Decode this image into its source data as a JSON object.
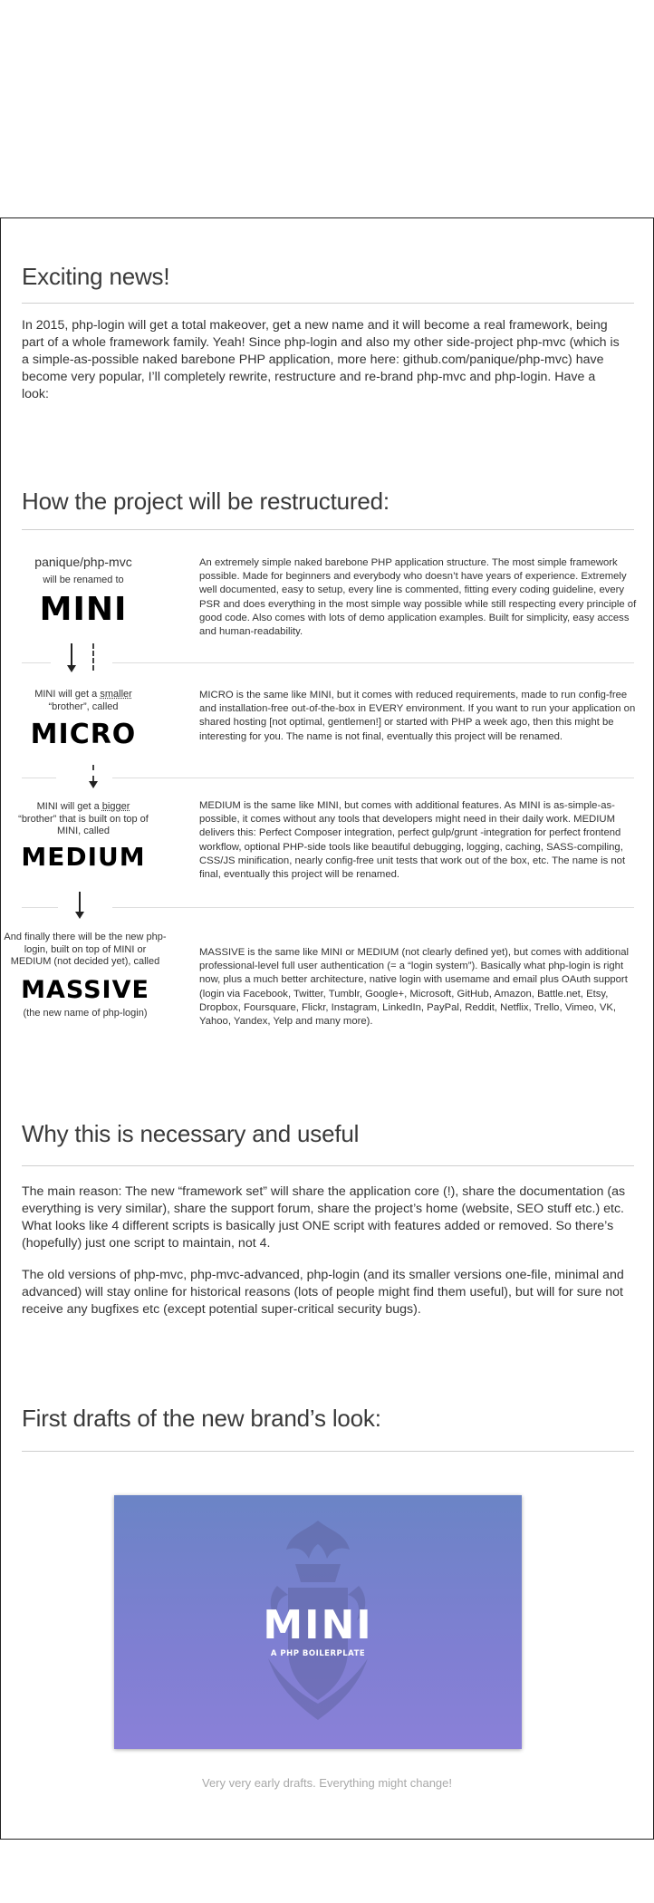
{
  "news": {
    "title": "Exciting news!",
    "intro": "In 2015, php-login will get a total makeover, get a new name and it will become a real framework, being part of a whole framework family. Yeah! Since php-login and also my other side-project php-mvc (which is a simple-as-possible naked barebone PHP application, more here: github.com/panique/php-mvc) have become very popular, I’ll completely rewrite, restructure and re-brand php-mvc and php-login. Have a look:"
  },
  "restructure": {
    "title": "How the project will be restructured:",
    "mini": {
      "repo": "panique/php-mvc",
      "note": "will be renamed to",
      "brand": "MINI",
      "description": "An extremely simple naked barebone PHP application structure. The most simple framework possible. Made for beginners and everybody who doesn’t have years of experience. Extremely well documented, easy to setup, every line is commented, fitting every coding guideline, every PSR and does everything in the most simple way possible while still respecting every principle of good code. Also comes with lots of demo application examples. Built for simplicity, easy access and human-readability."
    },
    "micro": {
      "note_before": "MINI will get a ",
      "note_word": "smaller",
      "note_after": "“brother”, called",
      "brand": "MICRO",
      "description": "MICRO is the same like MINI, but it comes with reduced requirements, made to run config-free and installation-free out-of-the-box in EVERY environment. If you want to run your application on shared hosting [not optimal, gentlemen!] or started with PHP a week ago, then this might be interesting for you. The name is not final, eventually this project will be renamed."
    },
    "medium": {
      "note_before": "MINI will get a ",
      "note_word": "bigger",
      "note_after": "“brother” that is built on top of MINI, called",
      "brand": "MEDIUM",
      "description": "MEDIUM is the same like MINI, but comes with additional features. As MINI is as-simple-as-possible, it comes without any tools that developers might need in their daily work. MEDIUM delivers this: Perfect Composer integration, perfect gulp/grunt -integration for perfect frontend workflow, optional PHP-side tools like beautiful debugging, logging, caching, SASS-compiling, CSS/JS minification, nearly config-free unit tests that work out of the box, etc. The name is not final, eventually this project will be renamed."
    },
    "massive": {
      "note": "And finally there will be the new php-login, built on top of MINI or MEDIUM (not decided yet), called",
      "brand": "MASSIVE",
      "sub": "(the new name of php-login)",
      "description": "MASSIVE is the same like MINI or MEDIUM (not clearly defined yet), but comes with additional professional-level full user authentication (= a “login system”). Basically what php-login is right now, plus a much better architecture, native login with usemame and email plus OAuth support (login via Facebook, Twitter, Tumblr, Google+, Microsoft, GitHub, Amazon, Battle.net, Etsy, Dropbox, Foursquare, Flickr, Instagram, LinkedIn, PayPal, Reddit, Netflix, Trello, Vimeo, VK, Yahoo, Yandex, Yelp and many more)."
    }
  },
  "why": {
    "title": "Why this is necessary and useful",
    "p1": "The main reason: The new “framework set” will share the application core (!), share the documentation (as everything is very similar), share the support forum, share the project’s home (website, SEO stuff etc.) etc. What looks like 4 different scripts is basically just ONE script with features added or removed. So there’s (hopefully) just one script to maintain, not 4.",
    "p2": "The old versions of php-mvc, php-mvc-advanced, php-login (and its smaller versions one-file, minimal and advanced) will stay online for historical reasons (lots of people might find them useful), but will for sure not receive any bugfixes etc (except potential super-critical security bugs)."
  },
  "drafts": {
    "title": "First drafts of the new brand’s look:",
    "card_word": "MINI",
    "card_sub": "A PHP BOILERPLATE",
    "caption": "Very very early drafts. Everything might change!"
  },
  "colors": {
    "card_top": "#6b84c6",
    "card_bottom": "#8a80d8",
    "text": "#333333",
    "caption": "#a8a8a8"
  }
}
